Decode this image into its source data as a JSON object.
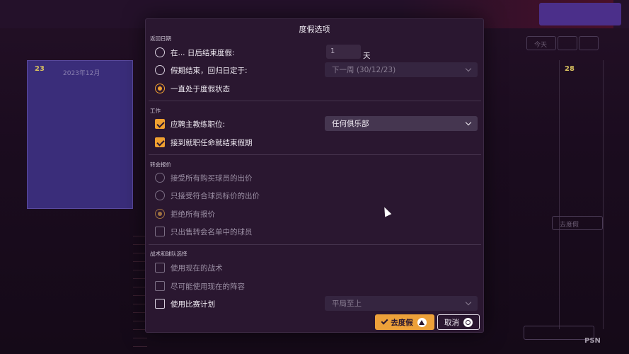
{
  "dialog": {
    "title": "度假选项",
    "return_section": {
      "label": "返回日期",
      "options": [
        {
          "label": "在... 日后结束度假:",
          "selected": false
        },
        {
          "label": "假期结束，回归日定于:",
          "selected": false
        },
        {
          "label": "一直处于度假状态",
          "selected": true
        }
      ],
      "days_value": "1",
      "days_unit": "天",
      "date_select": "下一周 (30/12/23)"
    },
    "work_section": {
      "label": "工作",
      "options": [
        {
          "label": "应聘主教练职位:",
          "checked": true
        },
        {
          "label": "接到就职任命就结束假期",
          "checked": true
        }
      ],
      "club_select": "任何俱乐部"
    },
    "transfer_section": {
      "label": "转会报价",
      "options": [
        {
          "label": "接受所有购买球员的出价",
          "selected": false
        },
        {
          "label": "只接受符合球员标价的出价",
          "selected": false
        },
        {
          "label": "拒绝所有报价",
          "selected": true
        },
        {
          "label": "只出售转会名单中的球员",
          "checked": false
        }
      ]
    },
    "tactics_section": {
      "label": "战术和球队选择",
      "options": [
        {
          "label": "使用现在的战术",
          "checked": false
        },
        {
          "label": "尽可能使用现在的阵容",
          "checked": false
        },
        {
          "label": "使用比赛计划",
          "checked": false
        }
      ],
      "plan_select": "平局至上"
    },
    "buttons": {
      "confirm": "去度假",
      "cancel": "取消"
    }
  },
  "background": {
    "calendar_day_23": "23",
    "calendar_month": "2023年12月",
    "calendar_day_28": "28",
    "today_button": "今天",
    "vacation_button": "去度假"
  },
  "watermark": "PSN",
  "colors": {
    "accent": "#eda13a",
    "dialog_bg": "#2a1730"
  }
}
